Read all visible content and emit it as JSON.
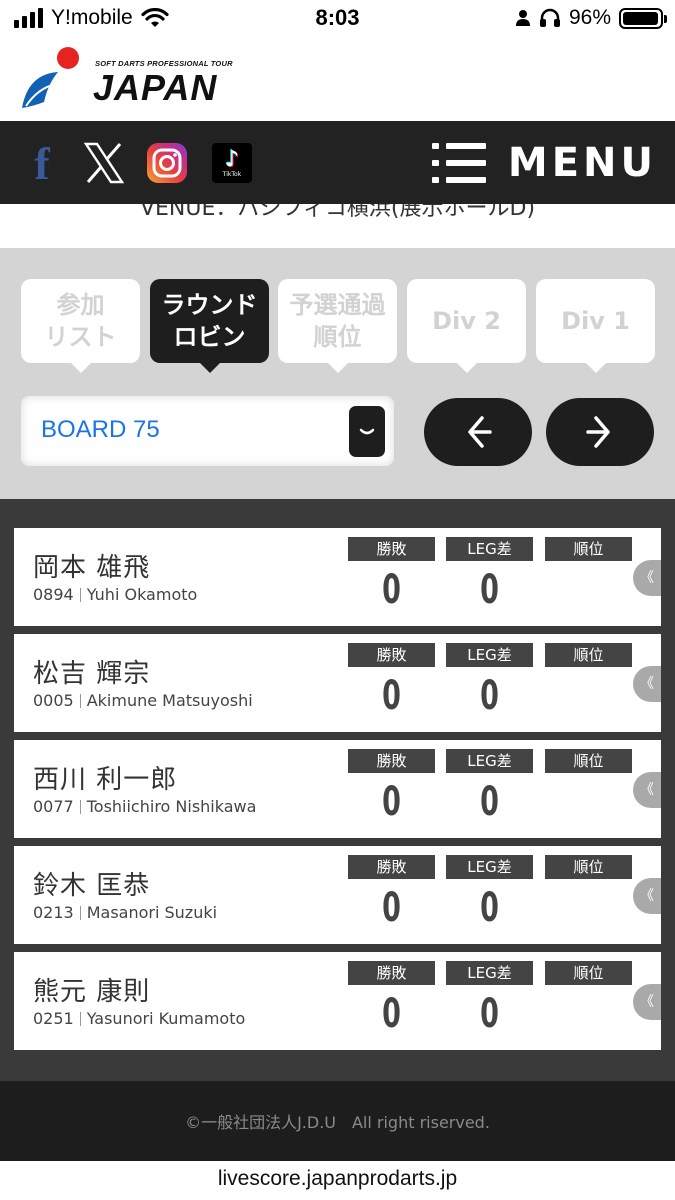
{
  "status_bar": {
    "carrier": "Y!mobile",
    "time": "8:03",
    "battery_percent": "96%",
    "battery_level": 0.96
  },
  "logo": {
    "subtitle": "SOFT DARTS PROFESSIONAL TOUR",
    "title": "JAPAN"
  },
  "nav": {
    "social_icons": [
      "facebook-icon",
      "x-icon",
      "instagram-icon",
      "tiktok-icon"
    ],
    "tiktok_label": "TikTok",
    "menu_label": "MENU"
  },
  "venue_partial": "VENUE：パシフィコ横浜(展示ホールD)",
  "tabs": [
    {
      "label": "参加\nリスト",
      "active": false
    },
    {
      "label": "ラウンド\nロビン",
      "active": true
    },
    {
      "label": "予選通過\n順位",
      "active": false
    },
    {
      "label": "Div 2",
      "active": false
    },
    {
      "label": "Div 1",
      "active": false
    }
  ],
  "board_select": {
    "value": "BOARD 75"
  },
  "stat_headers": {
    "win_loss": "勝敗",
    "leg_diff": "LEG差",
    "rank": "順位"
  },
  "players": [
    {
      "name": "岡本 雄飛",
      "id": "0894",
      "romaji": "Yuhi Okamoto",
      "win_loss": "0",
      "leg_diff": "0",
      "rank": ""
    },
    {
      "name": "松吉 輝宗",
      "id": "0005",
      "romaji": "Akimune Matsuyoshi",
      "win_loss": "0",
      "leg_diff": "0",
      "rank": ""
    },
    {
      "name": "西川 利一郎",
      "id": "0077",
      "romaji": "Toshiichiro Nishikawa",
      "win_loss": "0",
      "leg_diff": "0",
      "rank": ""
    },
    {
      "name": "鈴木 匡恭",
      "id": "0213",
      "romaji": "Masanori Suzuki",
      "win_loss": "0",
      "leg_diff": "0",
      "rank": ""
    },
    {
      "name": "熊元 康則",
      "id": "0251",
      "romaji": "Yasunori Kumamoto",
      "win_loss": "0",
      "leg_diff": "0",
      "rank": ""
    }
  ],
  "footer": {
    "copyright": "©一般社団法人J.D.U　All right riserved."
  },
  "url": "livescore.japanprodarts.jp",
  "colors": {
    "nav_bg": "#222222",
    "tab_area_bg": "#d4d4d4",
    "list_bg": "#3a3a3a",
    "board_value": "#1a73e8",
    "active_tab": "#1e1e1e"
  }
}
